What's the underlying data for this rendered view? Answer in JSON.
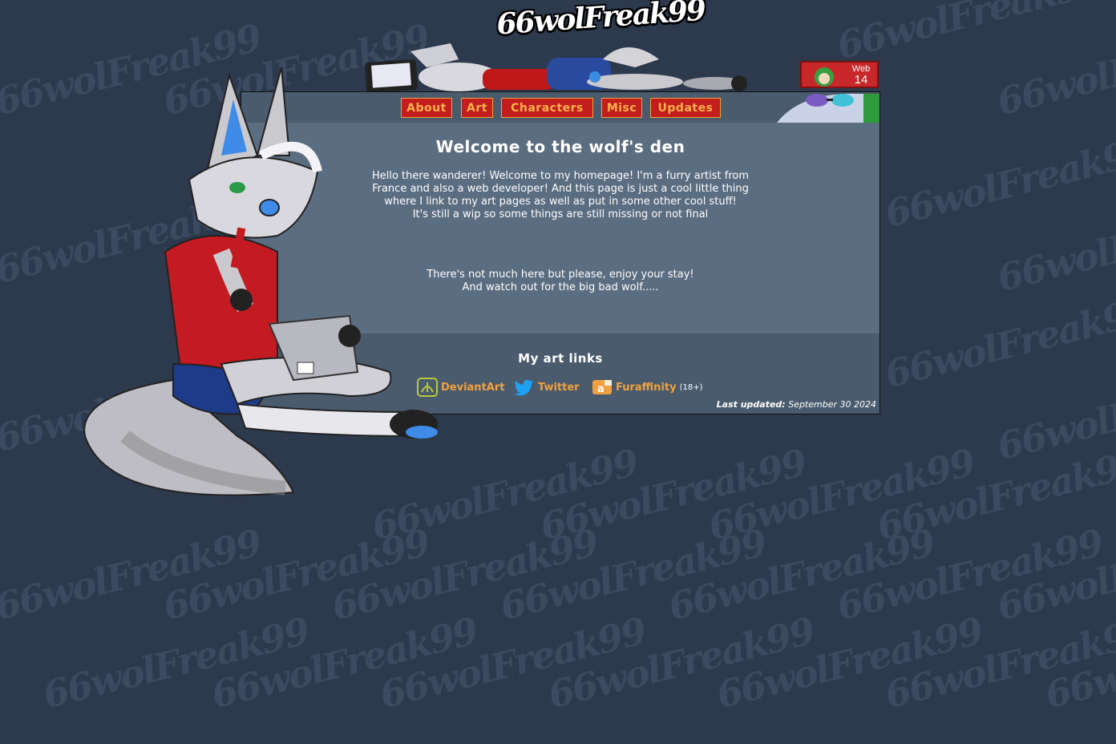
{
  "site": {
    "logo_text": "66wolFreak99",
    "watermark_text": "66wolFreak99"
  },
  "web_badge": {
    "line1": "Web",
    "line2": "14"
  },
  "nav": {
    "items": [
      {
        "label": "About"
      },
      {
        "label": "Art"
      },
      {
        "label": "Characters"
      },
      {
        "label": "Misc"
      },
      {
        "label": "Updates"
      }
    ]
  },
  "main": {
    "title": "Welcome to the wolf's den",
    "intro_lines": [
      "Hello there wanderer! Welcome to my homepage! I'm a furry artist from",
      "France and also a web developer! And this page is just a cool little thing",
      "where I link to my art pages as well as put in some other cool stuff!",
      "It's still a wip so some things are still missing or not final"
    ],
    "outro_lines": [
      "There's not much here but please, enjoy your stay!",
      "And watch out for the big bad wolf....."
    ]
  },
  "links": {
    "title": "My art links",
    "items": [
      {
        "label": "DeviantArt",
        "icon": "deviantart-icon",
        "note": ""
      },
      {
        "label": "Twitter",
        "icon": "twitter-bird-icon",
        "note": ""
      },
      {
        "label": "Furaffinity",
        "icon": "furaffinity-icon",
        "note": "(18+)"
      }
    ],
    "updated_label": "Last updated:",
    "updated_value": "September 30 2024"
  },
  "colors": {
    "background": "#2d3a4d",
    "panel": "#5b6d80",
    "nav_button": "#c41d1d",
    "nav_text": "#ffb24a",
    "link_text": "#f0a040"
  }
}
